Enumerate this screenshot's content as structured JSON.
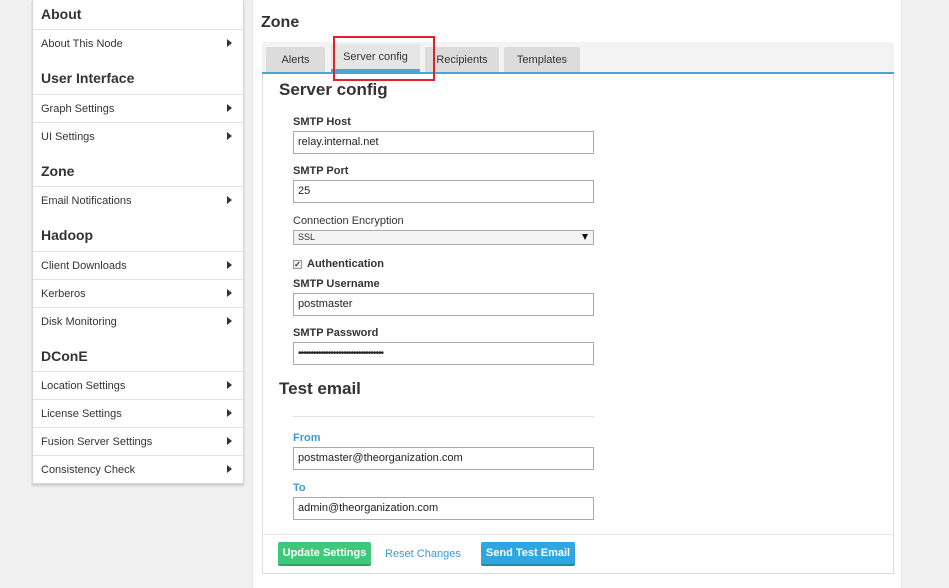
{
  "sidebar": {
    "sections": [
      {
        "title": "About",
        "items": [
          "About This Node"
        ]
      },
      {
        "title": "User Interface",
        "items": [
          "Graph Settings",
          "UI Settings"
        ]
      },
      {
        "title": "Zone",
        "items": [
          "Email Notifications"
        ]
      },
      {
        "title": "Hadoop",
        "items": [
          "Client Downloads",
          "Kerberos",
          "Disk Monitoring"
        ]
      },
      {
        "title": "DConE",
        "items": [
          "Location Settings",
          "License Settings",
          "Fusion Server Settings",
          "Consistency Check"
        ]
      }
    ]
  },
  "main": {
    "title": "Zone",
    "tabs": [
      "Alerts",
      "Server config",
      "Recipients",
      "Templates"
    ],
    "active_tab": "Server config",
    "server_config": {
      "heading": "Server config",
      "smtp_host_label": "SMTP Host",
      "smtp_host": "relay.internal.net",
      "smtp_port_label": "SMTP Port",
      "smtp_port": "25",
      "encryption_label": "Connection Encryption",
      "encryption": "SSL",
      "auth_label": "Authentication",
      "auth_checked": true,
      "username_label": "SMTP Username",
      "username": "postmaster",
      "password_label": "SMTP Password",
      "password": "••••••••••••••••••••••••••••••••••"
    },
    "test_email": {
      "heading": "Test email",
      "from_label": "From",
      "from": "postmaster@theorganization.com",
      "to_label": "To",
      "to": "admin@theorganization.com"
    },
    "buttons": {
      "update": "Update Settings",
      "reset": "Reset Changes",
      "send": "Send Test Email"
    }
  }
}
